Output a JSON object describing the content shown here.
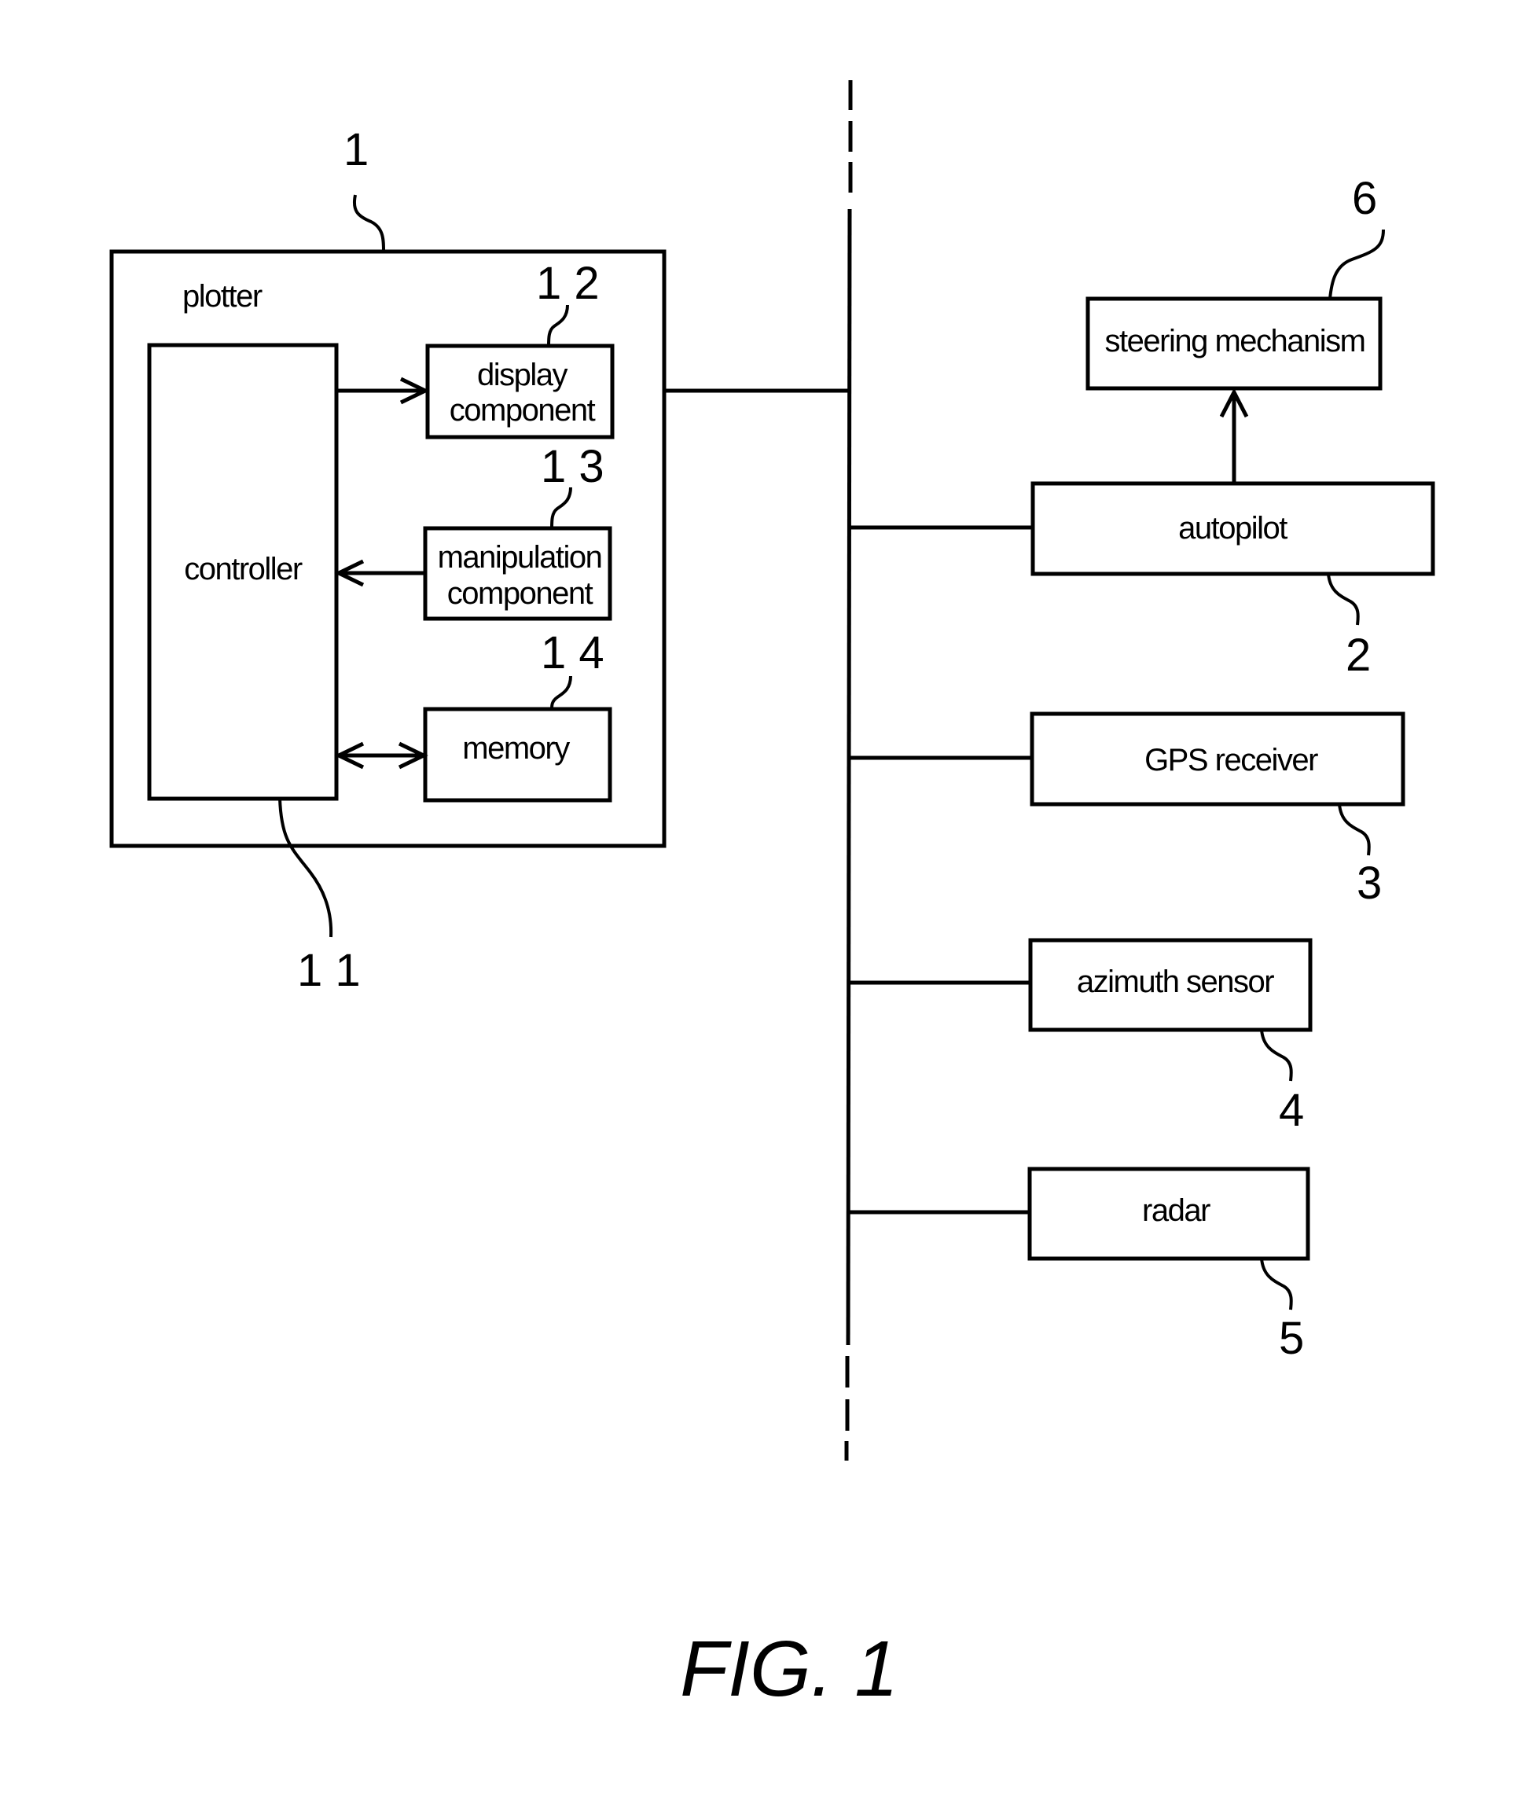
{
  "figure": {
    "caption": "FIG. 1",
    "plotter": {
      "ref": "1",
      "label": "plotter",
      "controller": {
        "ref": "1 1",
        "label": "controller"
      },
      "display": {
        "ref": "1 2",
        "line1": "display",
        "line2": "component"
      },
      "manipulation": {
        "ref": "1 3",
        "line1": "manipulation",
        "line2": "component"
      },
      "memory": {
        "ref": "1 4",
        "label": "memory"
      }
    },
    "devices": {
      "steering": {
        "ref": "6",
        "label": "steering mechanism"
      },
      "autopilot": {
        "ref": "2",
        "label": "autopilot"
      },
      "gps": {
        "ref": "3",
        "label": "GPS receiver"
      },
      "azimuth": {
        "ref": "4",
        "label": "azimuth sensor"
      },
      "radar": {
        "ref": "5",
        "label": "radar"
      }
    }
  }
}
